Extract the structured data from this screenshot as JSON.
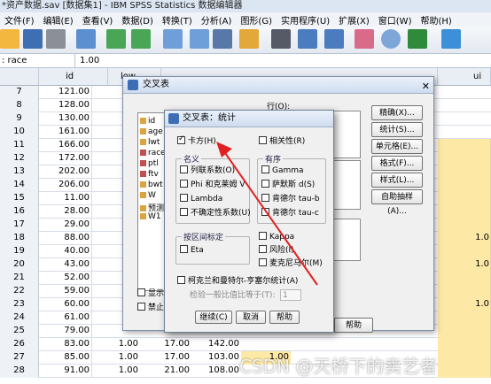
{
  "window": {
    "title": "*资产数据.sav [数据集1] - IBM SPSS Statistics 数据编辑器"
  },
  "menu": [
    "文件(F)",
    "编辑(E)",
    "查看(V)",
    "数据(D)",
    "转换(T)",
    "分析(A)",
    "图形(G)",
    "实用程序(U)",
    "扩展(X)",
    "窗口(W)",
    "帮助(H)"
  ],
  "cell_bar": {
    "name": ": race",
    "value": "1.00"
  },
  "grid": {
    "columns": [
      "id",
      "low",
      "ui"
    ],
    "rows": [
      {
        "n": "7",
        "id": "121.00"
      },
      {
        "n": "8",
        "id": "128.00"
      },
      {
        "n": "9",
        "id": "130.00"
      },
      {
        "n": "10",
        "id": "161.00"
      },
      {
        "n": "11",
        "id": "166.00"
      },
      {
        "n": "12",
        "id": "172.00"
      },
      {
        "n": "13",
        "id": "202.00"
      },
      {
        "n": "14",
        "id": "206.00"
      },
      {
        "n": "15",
        "id": "11.00"
      },
      {
        "n": "16",
        "id": "28.00"
      },
      {
        "n": "17",
        "id": "29.00"
      },
      {
        "n": "18",
        "id": "88.00"
      },
      {
        "n": "19",
        "id": "40.00"
      },
      {
        "n": "20",
        "id": "43.00"
      },
      {
        "n": "21",
        "id": "52.00"
      },
      {
        "n": "22",
        "id": "59.00"
      },
      {
        "n": "23",
        "id": "60.00"
      },
      {
        "n": "24",
        "id": "61.00"
      },
      {
        "n": "25",
        "id": "79.00"
      },
      {
        "n": "26",
        "id": "83.00"
      },
      {
        "n": "27",
        "id": "85.00"
      },
      {
        "n": "28",
        "id": "91.00"
      }
    ],
    "bottom_values": {
      "r26": [
        "1.00",
        "17.00",
        "142.00"
      ],
      "r27": [
        "1.00",
        "17.00",
        "103.00",
        "1.00"
      ],
      "r28": [
        "1.00",
        "21.00",
        "108.00"
      ]
    },
    "right_values": [
      "1.0",
      "1.0",
      "1.0"
    ]
  },
  "crosstab": {
    "title": "交叉表",
    "row_label": "行(O):",
    "buttons": [
      "精确(X)...",
      "统计(S)...",
      "单元格(E)...",
      "格式(F)...",
      "样式(L)...",
      "自助抽样(A)..."
    ],
    "variables": [
      "id",
      "age",
      "lwt",
      "race",
      "ptl",
      "ftv",
      "bwt",
      "W",
      "预测",
      "W1"
    ],
    "checkbox_1": "显示",
    "checkbox_2": "禁止",
    "help": "帮助"
  },
  "stats": {
    "title": "交叉表：统计",
    "chi_square": "卡方(H)",
    "correlations": "相关性(R)",
    "nominal": {
      "label": "名义",
      "items": [
        "列联系数(O)",
        "Phi 和克莱姆 V",
        "Lambda",
        "不确定性系数(U)"
      ]
    },
    "ordinal": {
      "label": "有序",
      "items": [
        "Gamma",
        "萨默斯 d(S)",
        "肯德尔 tau-b",
        "肯德尔 tau-c"
      ]
    },
    "interval": {
      "label": "按区间标定",
      "items": [
        "Eta"
      ]
    },
    "right_misc": [
      "Kappa",
      "风险(I)",
      "麦克尼马尔(M)"
    ],
    "cmh": "柯克兰和曼特尔-亨塞尔统计(A)",
    "cmh_test": "检验一般比值比等于(T):",
    "cmh_value": "1",
    "buttons": [
      "继续(C)",
      "取消",
      "帮助"
    ]
  },
  "watermark": "CSDN @天桥下的卖艺者"
}
